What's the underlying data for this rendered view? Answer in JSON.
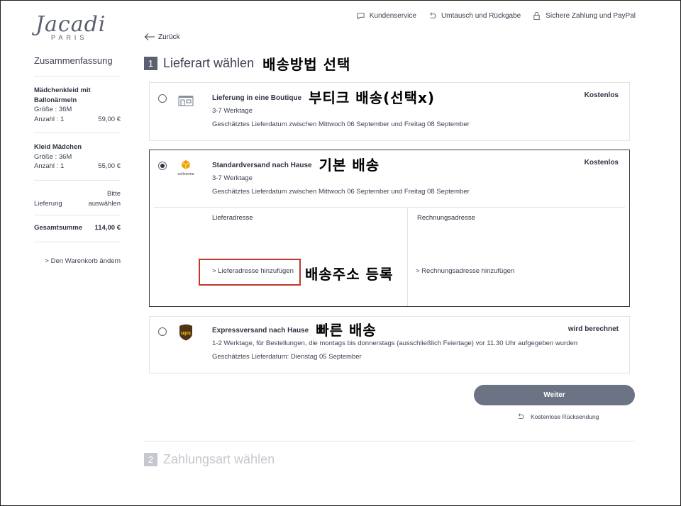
{
  "logo": {
    "word": "Jacadi",
    "sub": "PARIS"
  },
  "topnav": [
    {
      "label": "Kundenservice",
      "icon": "chat-icon"
    },
    {
      "label": "Umtausch und Rückgabe",
      "icon": "return-icon"
    },
    {
      "label": "Sichere Zahlung und PayPal",
      "icon": "lock-icon"
    }
  ],
  "sidebar": {
    "title": "Zusammenfassung",
    "items": [
      {
        "name": "Mädchenkleid mit Ballonärmeln",
        "size": "Größe : 36M",
        "qty": "Anzahl : 1",
        "price": "59,00 €"
      },
      {
        "name": "Kleid Mädchen",
        "size": "Größe : 36M",
        "qty": "Anzahl : 1",
        "price": "55,00 €"
      }
    ],
    "delivery_label": "Lieferung",
    "delivery_value": "Bitte auswählen",
    "total_label": "Gesamtsumme",
    "total_value": "114,00 €",
    "change_cart": "> Den Warenkorb ändern"
  },
  "back_label": "Zurück",
  "step1": {
    "num": "1",
    "title": "Lieferart wählen",
    "annotation": "배송방법 선택"
  },
  "step2": {
    "num": "2",
    "title": "Zahlungsart wählen"
  },
  "options": [
    {
      "title": "Lieferung in eine Boutique",
      "annotation": "부티크 배송(선택x)",
      "line1": "3-7 Werktage",
      "line2": "Geschätztes Lieferdatum zwischen Mittwoch 06 September und Freitag 08 September",
      "price": "Kostenlos",
      "selected": false
    },
    {
      "title": "Standardversand nach Hause",
      "annotation": "기본 배송",
      "line1": "3-7 Werktage",
      "line2": "Geschätztes Lieferdatum zwischen Mittwoch 06 September und Freitag 08 September",
      "price": "Kostenlos",
      "selected": true,
      "icon_label": "colissimo"
    },
    {
      "title": "Expressversand nach Hause",
      "annotation": "빠른 배송",
      "line1": "1-2 Werktage, für Bestellungen, die montags bis donnerstags (ausschließlich Feiertage) vor 11.30 Uhr aufgegeben wurden",
      "line2": "Geschätztes Lieferdatum: Dienstag 05 September",
      "price": "wird berechnet",
      "selected": false,
      "icon_label": "ups"
    }
  ],
  "address": {
    "delivery_head": "Lieferadresse",
    "delivery_link": "> Lieferadresse hinzufügen",
    "delivery_annotation": "배송주소 등록",
    "billing_head": "Rechnungsadresse",
    "billing_link": "> Rechnungsadresse hinzufügen"
  },
  "next_button": "Weiter",
  "free_return": "Kostenlose Rücksendung",
  "colors": {
    "button": "#6b7384",
    "highlight": "#c0392b",
    "text": "#3d4152"
  }
}
